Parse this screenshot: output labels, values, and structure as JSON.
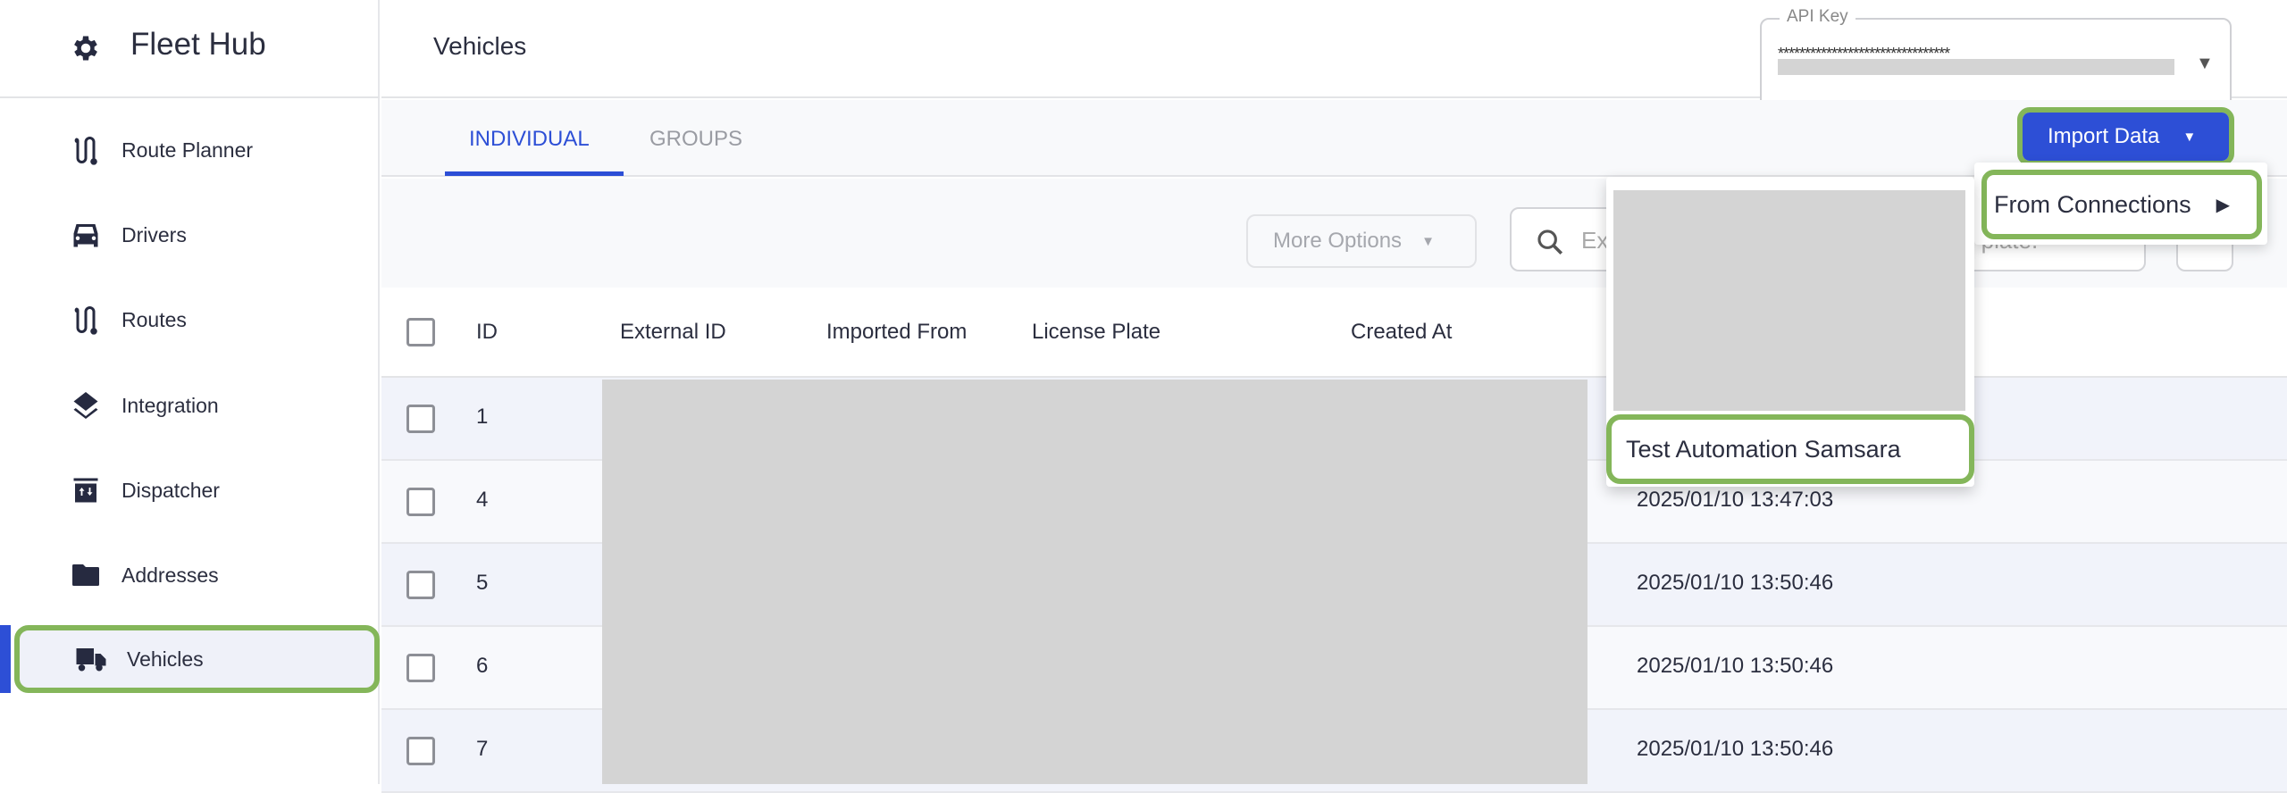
{
  "app": {
    "title": "Fleet Hub",
    "brand_icon": "gear-icon"
  },
  "sidebar": {
    "items": [
      {
        "label": "Route Planner",
        "icon": "route-icon"
      },
      {
        "label": "Drivers",
        "icon": "car-icon"
      },
      {
        "label": "Routes",
        "icon": "route-icon"
      },
      {
        "label": "Integration",
        "icon": "layers-icon"
      },
      {
        "label": "Dispatcher",
        "icon": "archive-icon"
      },
      {
        "label": "Addresses",
        "icon": "folder-icon"
      },
      {
        "label": "Vehicles",
        "icon": "truck-icon",
        "active": true
      }
    ]
  },
  "header": {
    "title": "Vehicles",
    "api_key": {
      "label": "API Key",
      "value": "********************************"
    }
  },
  "tabs": [
    {
      "label": "INDIVIDUAL",
      "active": true
    },
    {
      "label": "GROUPS"
    }
  ],
  "toolbar": {
    "more_options": "More Options",
    "search_placeholder_start": "Ex",
    "search_placeholder_end": "ense plate.",
    "import_label": "Import Data"
  },
  "import_menu": {
    "items": [
      {
        "label": "From Connections"
      }
    ],
    "submenu": [
      {
        "label": "Test Automation Samsara"
      }
    ]
  },
  "table": {
    "columns": [
      "ID",
      "External ID",
      "Imported From",
      "License Plate",
      "Created At"
    ],
    "rows": [
      {
        "id": "1",
        "created_at": ""
      },
      {
        "id": "4",
        "created_at": "2025/01/10 13:47:03"
      },
      {
        "id": "5",
        "created_at": "2025/01/10 13:50:46"
      },
      {
        "id": "6",
        "created_at": "2025/01/10 13:50:46"
      },
      {
        "id": "7",
        "created_at": "2025/01/10 13:50:46"
      }
    ]
  },
  "colors": {
    "accent": "#2d4fd6",
    "highlight": "#84b65a"
  }
}
